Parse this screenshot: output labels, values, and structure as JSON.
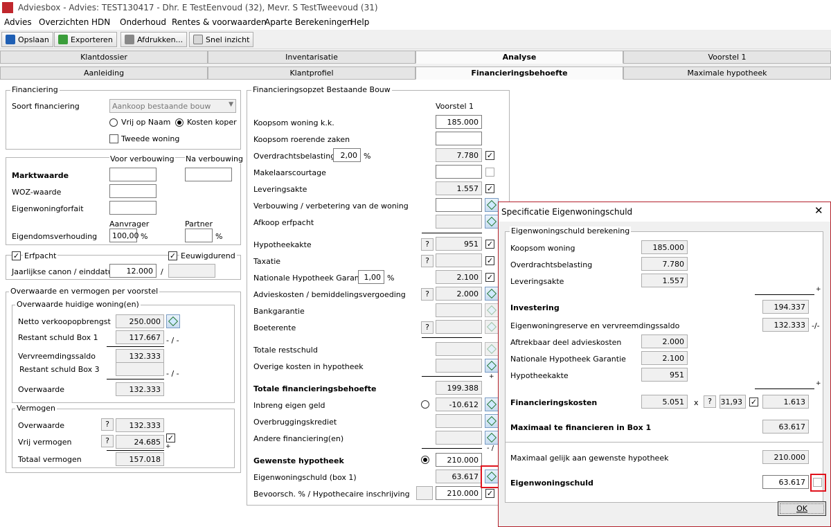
{
  "window": {
    "title": "Adviesbox - Advies: TEST130417 - Dhr. E TestEenvoud (32), Mevr. S TestTweevoud (31)"
  },
  "menu": [
    "Advies",
    "Overzichten",
    "HDN",
    "Onderhoud",
    "Rentes & voorwaarden",
    "Aparte Berekeningen",
    "Help"
  ],
  "toolbar": {
    "save": "Opslaan",
    "export": "Exporteren",
    "print": "Afdrukken...",
    "snel": "Snel inzicht"
  },
  "tabs_top": [
    "Klantdossier",
    "Inventarisatie",
    "Analyse",
    "Voorstel 1"
  ],
  "tabs_sub": [
    "Aanleiding",
    "Klantprofiel",
    "Financieringsbehoefte",
    "Maximale hypotheek"
  ],
  "financiering": {
    "legend": "Financiering",
    "soort_label": "Soort financiering",
    "soort_value": "Aankoop bestaande bouw",
    "vrij_op_naam": "Vrij op Naam",
    "kosten_koper": "Kosten koper",
    "tweede_woning": "Tweede woning"
  },
  "waarde": {
    "voor": "Voor verbouwing",
    "na": "Na verbouwing",
    "marktwaarde": "Marktwaarde",
    "woz": "WOZ-waarde",
    "eigenwoningforfait": "Eigenwoningforfait",
    "aanvrager": "Aanvrager",
    "partner": "Partner",
    "eigendomsverhouding": "Eigendomsverhouding",
    "aanvrager_pct": "100,00",
    "pct": "%"
  },
  "erfpacht": {
    "erfpacht": "Erfpacht",
    "eeuwigdurend": "Eeuwigdurend",
    "canon_label": "Jaarlijkse canon / einddatum",
    "canon": "12.000",
    "slash": "/"
  },
  "overwaarde": {
    "legend": "Overwaarde en vermogen per voorstel",
    "sub": "Overwaarde huidige woning(en)",
    "netto": "Netto verkoopopbrengst",
    "netto_v": "250.000",
    "restant1": "Restant schuld Box 1",
    "restant1_v": "117.667",
    "vervreemd": "Vervreemdingssaldo",
    "vervreemd_v": "132.333",
    "restant3": "Restant schuld Box 3",
    "overwaarde": "Overwaarde",
    "overwaarde_v": "132.333",
    "minus": "- / -"
  },
  "vermogen": {
    "legend": "Vermogen",
    "overwaarde": "Overwaarde",
    "overwaarde_v": "132.333",
    "vrij": "Vrij vermogen",
    "vrij_v": "24.685",
    "totaal": "Totaal vermogen",
    "totaal_v": "157.018",
    "q": "?",
    "plus": "+"
  },
  "opzet": {
    "legend": "Financieringsopzet Bestaande Bouw",
    "col": "Voorstel 1",
    "rows": [
      {
        "label": "Koopsom woning k.k.",
        "value": "185.000"
      },
      {
        "label": "Koopsom roerende zaken",
        "value": ""
      },
      {
        "label": "Overdrachtsbelasting",
        "value": "7.780",
        "pct": "2,00"
      },
      {
        "label": "Makelaarscourtage",
        "value": ""
      },
      {
        "label": "Leveringsakte",
        "value": "1.557"
      },
      {
        "label": "Verbouwing / verbetering van de woning",
        "value": ""
      },
      {
        "label": "Afkoop erfpacht",
        "value": ""
      },
      {
        "label": "Hypotheekakte",
        "value": "951"
      },
      {
        "label": "Taxatie",
        "value": ""
      },
      {
        "label": "Nationale Hypotheek Garantie",
        "value": "2.100",
        "pct": "1,00"
      },
      {
        "label": "Advieskosten / bemiddelingsvergoeding",
        "value": "2.000"
      },
      {
        "label": "Bankgarantie",
        "value": ""
      },
      {
        "label": "Boeterente",
        "value": ""
      },
      {
        "label": "Totale restschuld",
        "value": ""
      },
      {
        "label": "Overige kosten in hypotheek",
        "value": ""
      },
      {
        "label": "Totale financieringsbehoefte",
        "value": "199.388"
      },
      {
        "label": "Inbreng eigen geld",
        "value": "-10.612"
      },
      {
        "label": "Overbruggingskrediet",
        "value": ""
      },
      {
        "label": "Andere financiering(en)",
        "value": ""
      },
      {
        "label": "Gewenste hypotheek",
        "value": "210.000"
      },
      {
        "label": "Eigenwoningschuld (box 1)",
        "value": "63.617"
      },
      {
        "label": "Bevoorsch. % / Hypothecaire inschrijving",
        "value": "210.000"
      }
    ],
    "pct": "%",
    "q": "?",
    "plus": "+",
    "minus": "- /"
  },
  "dialog": {
    "title": "Specificatie Eigenwoningschuld",
    "legend": "Eigenwoningschuld berekening",
    "koopsom": "Koopsom woning",
    "koopsom_v": "185.000",
    "overdracht": "Overdrachtsbelasting",
    "overdracht_v": "7.780",
    "levering": "Leveringsakte",
    "levering_v": "1.557",
    "investering": "Investering",
    "investering_v": "194.337",
    "ewr": "Eigenwoningreserve en vervreemdingssaldo",
    "ewr_v": "132.333",
    "ewr_sign": "-/-",
    "aftrekbaar": "Aftrekbaar deel advieskosten",
    "aftrekbaar_v": "2.000",
    "nhg": "Nationale Hypotheek Garantie",
    "nhg_v": "2.100",
    "akte": "Hypotheekakte",
    "akte_v": "951",
    "fk": "Financieringskosten",
    "fk_v": "5.051",
    "fk_x": "x",
    "fk_pct": "31,93",
    "fk_res": "1.613",
    "max": "Maximaal te financieren in Box 1",
    "max_v": "63.617",
    "gelijk": "Maximaal gelijk aan gewenste hypotheek",
    "gelijk_v": "210.000",
    "ews": "Eigenwoningschuld",
    "ews_v": "63.617",
    "plus": "+",
    "q": "?",
    "ok": "OK",
    "close": "✕"
  }
}
